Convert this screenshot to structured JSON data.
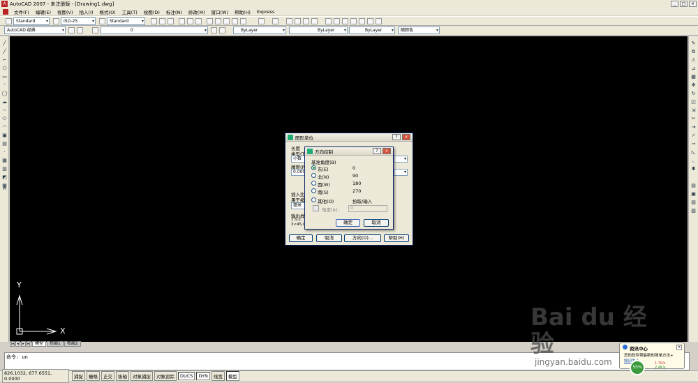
{
  "app": {
    "title": "AutoCAD 2007 - 未注册版 - [Drawing1.dwg]"
  },
  "menu": [
    "文件(F)",
    "编辑(E)",
    "视图(V)",
    "插入(I)",
    "格式(O)",
    "工具(T)",
    "绘图(D)",
    "标注(N)",
    "修改(M)",
    "窗口(W)",
    "帮助(H)",
    "Express"
  ],
  "toolbar": {
    "text_style": "Standard",
    "dim_style": "ISO-25",
    "table_style": "Standard",
    "workspace": "AutoCAD 经典",
    "layer": "0",
    "color": "ByLayer",
    "linetype": "ByLayer",
    "lineweight": "ByLayer",
    "plotstyle": "随颜色"
  },
  "layout_tabs": [
    "模型",
    "布局1",
    "布局2"
  ],
  "ucs": {
    "y": "Y",
    "x": "X"
  },
  "command": {
    "prompt": "命令: un"
  },
  "status": {
    "coords": "826.1032, 677.6551, 0.0000",
    "buttons": [
      {
        "label": "捕捉",
        "on": false
      },
      {
        "label": "栅格",
        "on": false
      },
      {
        "label": "正交",
        "on": false
      },
      {
        "label": "极轴",
        "on": false
      },
      {
        "label": "对象捕捉",
        "on": false
      },
      {
        "label": "对象追踪",
        "on": false
      },
      {
        "label": "DUCS",
        "on": true
      },
      {
        "label": "DYN",
        "on": true
      },
      {
        "label": "线宽",
        "on": false
      },
      {
        "label": "模型",
        "on": true
      }
    ]
  },
  "units_dialog": {
    "title": "图形单位",
    "length_label": "长度",
    "angle_label": "角度",
    "type_label": "类型(T)",
    "type_value": "小数",
    "precision_label": "精度(P)",
    "precision_value": "0.0000",
    "insert_label": "插入比",
    "insert_sub": "用于缩",
    "insert_value": "毫米",
    "output_label": "输出样",
    "output_l1": "1.5,2.",
    "output_l2": "3<45,0",
    "ok": "确定",
    "cancel": "取消",
    "direction": "方向(D)...",
    "help": "帮助(H)"
  },
  "direction_dialog": {
    "title": "方向控制",
    "base_angle": "基准角度(B)",
    "options": [
      {
        "label": "东(E)",
        "value": "0",
        "selected": true
      },
      {
        "label": "北(N)",
        "value": "90",
        "selected": false
      },
      {
        "label": "西(W)",
        "value": "180",
        "selected": false
      },
      {
        "label": "南(S)",
        "value": "270",
        "selected": false
      },
      {
        "label": "其他(O)",
        "value": "拾取/输入",
        "selected": false
      }
    ],
    "angle_label": "角度(A):",
    "angle_value": "0",
    "ok": "确定",
    "cancel": "取消"
  },
  "watermark": {
    "brand": "Bai du 经验",
    "url": "jingyan.baidu.com"
  },
  "notification": {
    "title": "资讯中心",
    "text": "您的软件带最新的简单方法+",
    "link": "知识中心",
    "percent": "55%",
    "up": "1.7K/s",
    "down": "2.4K/s"
  }
}
